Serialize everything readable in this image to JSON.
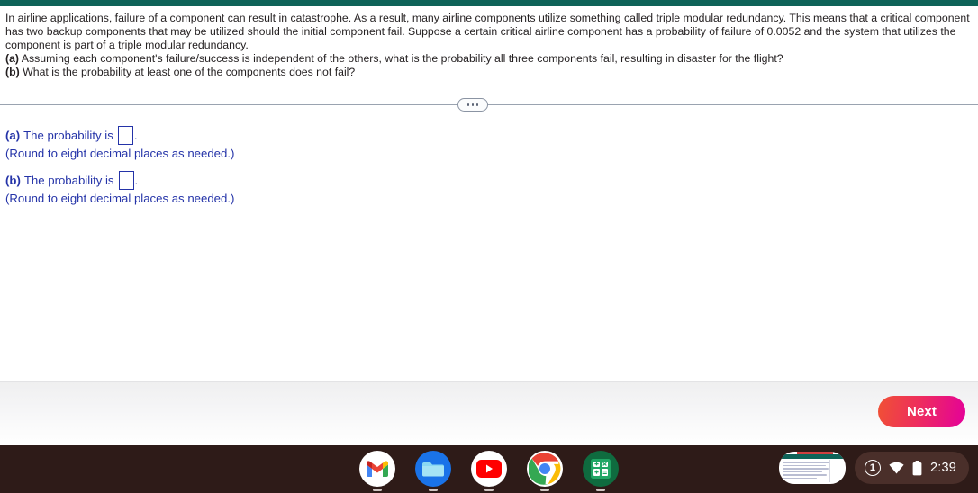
{
  "top_bar": {
    "color": "#0E6358"
  },
  "problem": {
    "paragraph": "In airline applications, failure of a component can result in catastrophe. As a result, many airline components utilize something called triple modular redundancy. This means that a critical component has two backup components that may be utilized should the initial component fail. Suppose a certain critical airline component has a probability of failure of 0.0052 and the system that utilizes the component is part of a triple modular redundancy.",
    "parts": [
      {
        "label": "(a)",
        "text": "Assuming each component's failure/success is independent of the others, what is the probability all three components fail, resulting in disaster for the flight?"
      },
      {
        "label": "(b)",
        "text": "What is the probability at least one of the components does not fail?"
      }
    ]
  },
  "divider": {
    "handle_dots": "•••"
  },
  "answers": {
    "text_color": "#2433A8",
    "blocks": [
      {
        "label": "(a)",
        "phrase": "The probability is",
        "value": "",
        "placeholder": "",
        "period": ".",
        "note": "(Round to eight decimal places as needed.)"
      },
      {
        "label": "(b)",
        "phrase": "The probability is",
        "value": "",
        "placeholder": "",
        "period": ".",
        "note": "(Round to eight decimal places as needed.)"
      }
    ]
  },
  "footer": {
    "next_label": "Next",
    "next_gradient_start": "#F05134",
    "next_gradient_end": "#E4009A"
  },
  "shelf": {
    "background": "#2E1B18",
    "apps": [
      {
        "name": "gmail-icon",
        "label": "Gmail"
      },
      {
        "name": "files-icon",
        "label": "Files"
      },
      {
        "name": "youtube-icon",
        "label": "YouTube"
      },
      {
        "name": "chrome-icon",
        "label": "Chrome"
      },
      {
        "name": "sheets-icon",
        "label": "Sheets"
      }
    ],
    "status": {
      "notification_count": "1",
      "wifi": "wifi-icon",
      "battery": "battery-icon",
      "clock": "2:39"
    }
  }
}
